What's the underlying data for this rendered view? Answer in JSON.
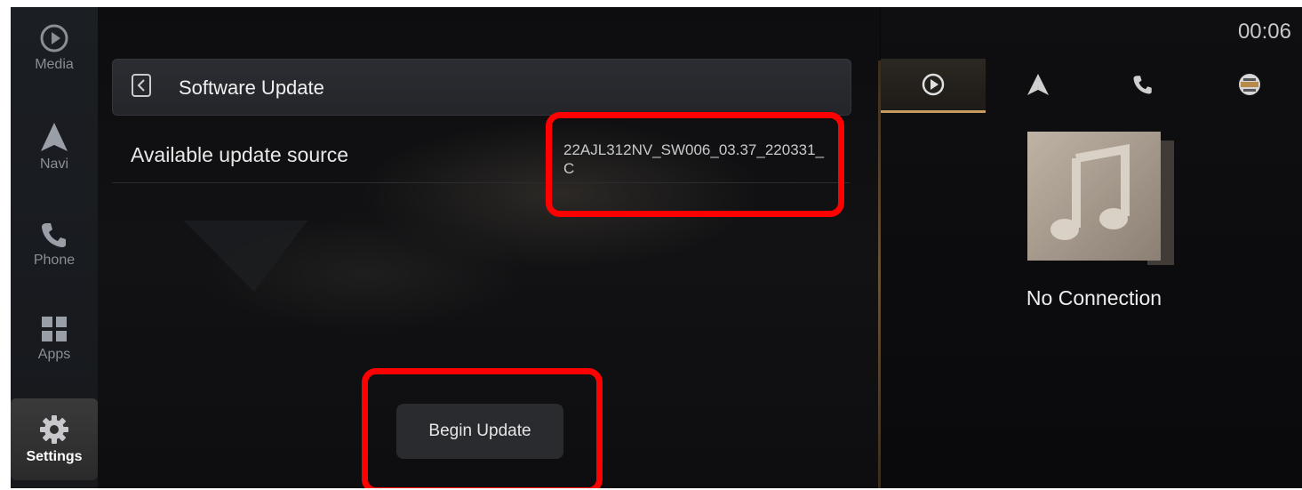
{
  "sidebar": {
    "items": [
      {
        "label": "Media",
        "icon": "play-circle-icon"
      },
      {
        "label": "Navi",
        "icon": "navigation-arrow-icon"
      },
      {
        "label": "Phone",
        "icon": "phone-icon"
      },
      {
        "label": "Apps",
        "icon": "apps-grid-icon"
      },
      {
        "label": "Settings",
        "icon": "gear-icon",
        "active": true
      }
    ]
  },
  "header": {
    "title": "Software Update"
  },
  "update": {
    "source_label": "Available update source",
    "source_value": "22AJL312NV_SW006_03.37_220331_C",
    "begin_button": "Begin Update"
  },
  "status_bar": {
    "time": "00:06"
  },
  "right_panel": {
    "tabs": [
      {
        "icon": "play-circle-icon",
        "active": true
      },
      {
        "icon": "navigation-arrow-icon"
      },
      {
        "icon": "phone-icon"
      },
      {
        "icon": "vehicle-icon"
      }
    ],
    "album_icon": "music-note-icon",
    "status": "No Connection"
  },
  "colors": {
    "accent": "#c59b62",
    "highlight": "#ff0000",
    "background": "#07080a"
  }
}
